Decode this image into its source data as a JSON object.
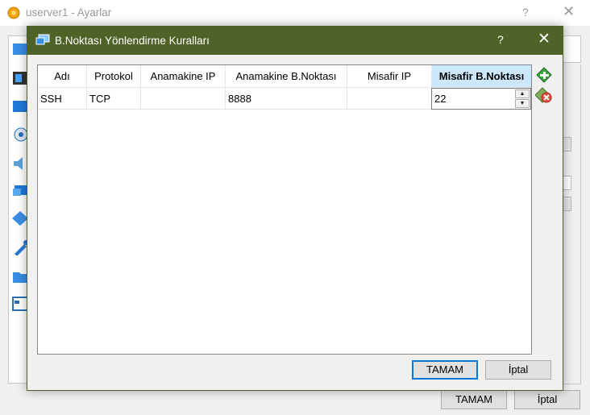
{
  "parent": {
    "title": "userver1 - Ayarlar",
    "help": "?",
    "close": "✕",
    "ok_label": "TAMAM",
    "cancel_label": "İptal"
  },
  "dialog": {
    "title": "B.Noktası Yönlendirme Kuralları",
    "help": "?",
    "close": "✕",
    "ok_label": "TAMAM",
    "cancel_label": "İptal",
    "add_rule_icon": "add-rule-icon",
    "remove_rule_icon": "remove-rule-icon"
  },
  "table": {
    "headers": [
      "Adı",
      "Protokol",
      "Anamakine IP",
      "Anamakine B.Noktası",
      "Misafir IP",
      "Misafir B.Noktası"
    ],
    "rows": [
      {
        "name": "SSH",
        "protocol": "TCP",
        "host_ip": "",
        "host_port": "8888",
        "guest_ip": "",
        "guest_port": "22"
      }
    ]
  },
  "colors": {
    "dialog_titlebar": "#4f6228",
    "selected_header": "#cce8ff",
    "default_button_border": "#0078d7"
  }
}
